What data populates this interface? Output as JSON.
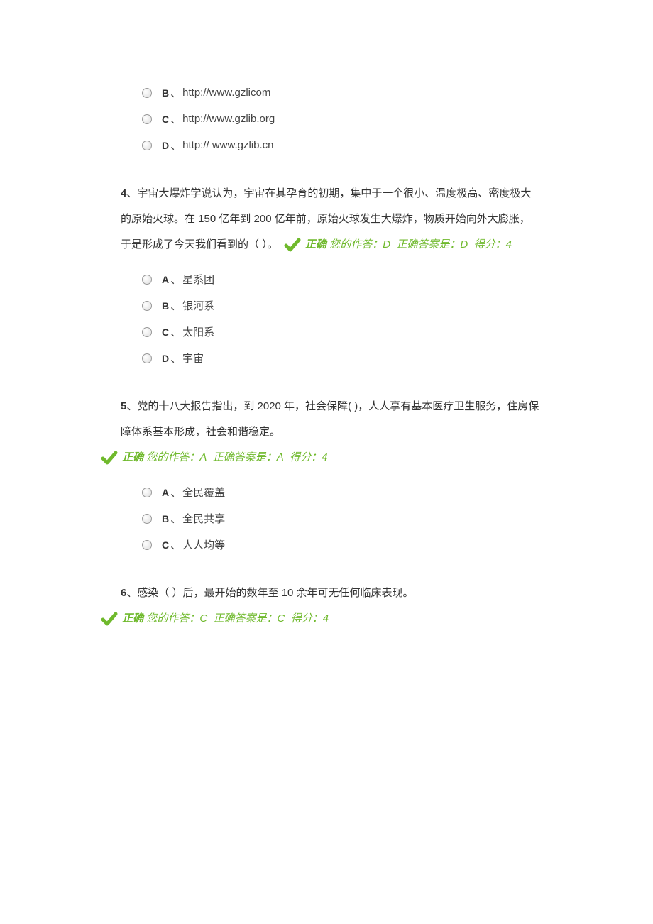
{
  "q3_tail_options": [
    {
      "letter": "B",
      "text": "http://www.gzlicom"
    },
    {
      "letter": "C",
      "text": "http://www.gzlib.org"
    },
    {
      "letter": "D",
      "text": "http:// www.gzlib.cn"
    }
  ],
  "q4": {
    "number": "4",
    "text_a": "、宇宙大爆炸学说认为，宇宙在其孕育的初期，集中于一个很小、温度极高、密度极大的原始火球。在 ",
    "num1": "150",
    "mid1": " 亿年到 ",
    "num2": "200",
    "text_b": " 亿年前，原始火球发生大爆炸，物质开始向外大膨胀，于是形成了今天我们看到的（ ）。",
    "correct_label": "正确",
    "your_answer": "您的作答：D",
    "correct_answer": "正确答案是：D",
    "score": "得分：4",
    "options": [
      {
        "letter": "A",
        "text": "星系团"
      },
      {
        "letter": "B",
        "text": "银河系"
      },
      {
        "letter": "C",
        "text": "太阳系"
      },
      {
        "letter": "D",
        "text": "宇宙"
      }
    ]
  },
  "q5": {
    "number": "5",
    "text_a": "、党的十八大报告指出，到 ",
    "yr": "2020",
    "text_b": " 年，社会保障( )，人人享有基本医疗卫生服务，住房保障体系基本形成，社会和谐稳定。",
    "correct_label": "正确",
    "your_answer": "您的作答：A",
    "correct_answer": "正确答案是：A",
    "score": "得分：4",
    "options": [
      {
        "letter": "A",
        "text": "全民覆盖"
      },
      {
        "letter": "B",
        "text": "全民共享"
      },
      {
        "letter": "C",
        "text": "人人均等"
      }
    ]
  },
  "q6": {
    "number": "6",
    "text_a": "、感染（ ）后，最开始的数年至 ",
    "num": "10",
    "text_b": " 余年可无任何临床表现。",
    "correct_label": "正确",
    "your_answer": "您的作答：C",
    "correct_answer": "正确答案是：C",
    "score": "得分：4"
  },
  "punct": "、"
}
